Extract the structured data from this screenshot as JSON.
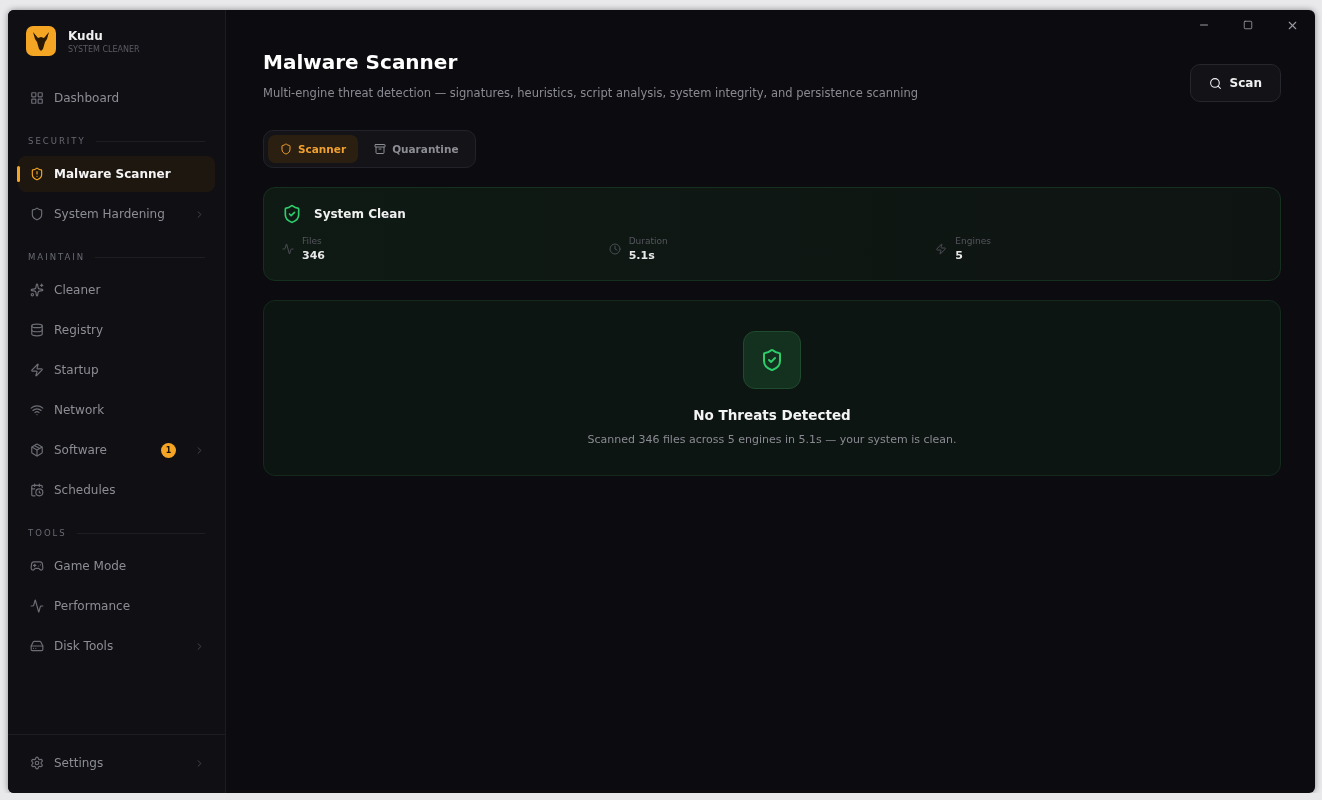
{
  "app": {
    "name": "Kudu",
    "subtitle": "SYSTEM CLEANER"
  },
  "sidebar": {
    "top": [
      {
        "label": "Dashboard",
        "selected": false,
        "expandable": false
      }
    ],
    "sections": [
      {
        "heading": "SECURITY",
        "items": [
          {
            "label": "Malware Scanner",
            "selected": true,
            "expandable": false
          },
          {
            "label": "System Hardening",
            "selected": false,
            "expandable": true
          }
        ]
      },
      {
        "heading": "MAINTAIN",
        "items": [
          {
            "label": "Cleaner",
            "selected": false,
            "expandable": false
          },
          {
            "label": "Registry",
            "selected": false,
            "expandable": false
          },
          {
            "label": "Startup",
            "selected": false,
            "expandable": false
          },
          {
            "label": "Network",
            "selected": false,
            "expandable": false
          },
          {
            "label": "Software",
            "selected": false,
            "expandable": true,
            "badge": "1"
          },
          {
            "label": "Schedules",
            "selected": false,
            "expandable": false
          }
        ]
      },
      {
        "heading": "TOOLS",
        "items": [
          {
            "label": "Game Mode",
            "selected": false,
            "expandable": false
          },
          {
            "label": "Performance",
            "selected": false,
            "expandable": false
          },
          {
            "label": "Disk Tools",
            "selected": false,
            "expandable": true
          }
        ]
      }
    ],
    "bottom": {
      "label": "Settings",
      "selected": false,
      "expandable": true
    }
  },
  "page": {
    "title": "Malware Scanner",
    "description": "Multi-engine threat detection — signatures, heuristics, script analysis, system integrity, and persistence scanning",
    "action": "Scan"
  },
  "tabs": [
    {
      "label": "Scanner",
      "selected": true
    },
    {
      "label": "Quarantine",
      "selected": false
    }
  ],
  "summary": {
    "title": "System Clean",
    "stats": [
      {
        "label": "Files",
        "value": "346"
      },
      {
        "label": "Duration",
        "value": "5.1s"
      },
      {
        "label": "Engines",
        "value": "5"
      }
    ]
  },
  "result": {
    "title": "No Threats Detected",
    "message": "Scanned 346 files across 5 engines in 5.1s — your system is clean."
  }
}
